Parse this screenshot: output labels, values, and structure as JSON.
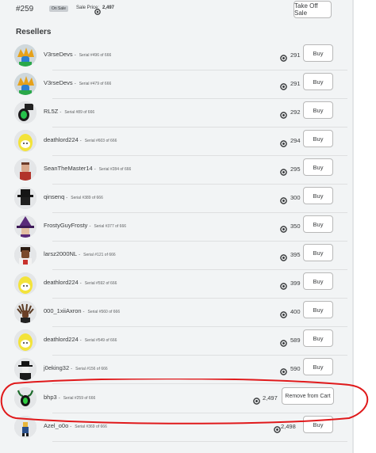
{
  "sale": {
    "serial": "#259",
    "badge": "On Sale",
    "price_label": "Sale Price:",
    "price_value": "2,497",
    "take_off_label": "Take Off Sale"
  },
  "resellers": {
    "title": "Resellers",
    "buy_label": "Buy",
    "remove_label": "Remove from Cart",
    "rows": [
      {
        "username": "V3rseDevs",
        "serial": "Serial #496 of 666",
        "price": "291",
        "action": "buy",
        "avatar": "crown"
      },
      {
        "username": "V3rseDevs",
        "serial": "Serial #479 of 666",
        "price": "291",
        "action": "buy",
        "avatar": "crown"
      },
      {
        "username": "RL5Z",
        "serial": "Serial #89 of 666",
        "price": "292",
        "action": "buy",
        "avatar": "green"
      },
      {
        "username": "deathlord224",
        "serial": "Serial #603 of 666",
        "price": "294",
        "action": "buy",
        "avatar": "egg"
      },
      {
        "username": "SeanTheMaster14",
        "serial": "Serial #284 of 666",
        "price": "295",
        "action": "buy",
        "avatar": "red"
      },
      {
        "username": "qinsenq",
        "serial": "Serial #389 of 666",
        "price": "300",
        "action": "buy",
        "avatar": "hat"
      },
      {
        "username": "FrostyGuyFrosty",
        "serial": "Serial #377 of 666",
        "price": "350",
        "action": "buy",
        "avatar": "witch"
      },
      {
        "username": "larsz2000NL",
        "serial": "Serial #121 of 666",
        "price": "395",
        "action": "buy",
        "avatar": "dark"
      },
      {
        "username": "deathlord224",
        "serial": "Serial #592 of 666",
        "price": "399",
        "action": "buy",
        "avatar": "egg"
      },
      {
        "username": "000_1xiiAxron",
        "serial": "Serial #560 of 666",
        "price": "400",
        "action": "buy",
        "avatar": "dread"
      },
      {
        "username": "deathlord224",
        "serial": "Serial #549 of 666",
        "price": "589",
        "action": "buy",
        "avatar": "egg"
      },
      {
        "username": "j0eking32",
        "serial": "Serial #156 of 666",
        "price": "590",
        "action": "buy",
        "avatar": "fedora"
      },
      {
        "username": "bhp3",
        "serial": "Serial #259 of 666",
        "price": "2,497",
        "action": "remove",
        "avatar": "horns"
      },
      {
        "username": "Azel_o0o",
        "serial": "Serial #369 of 666",
        "price": "2,498",
        "action": "buy",
        "avatar": "small"
      }
    ]
  },
  "colors": {
    "panel_bg": "#f2f4f5",
    "highlight": "#e0191b",
    "text": "#393b3d"
  },
  "icons": {
    "robux": "robux-icon"
  }
}
